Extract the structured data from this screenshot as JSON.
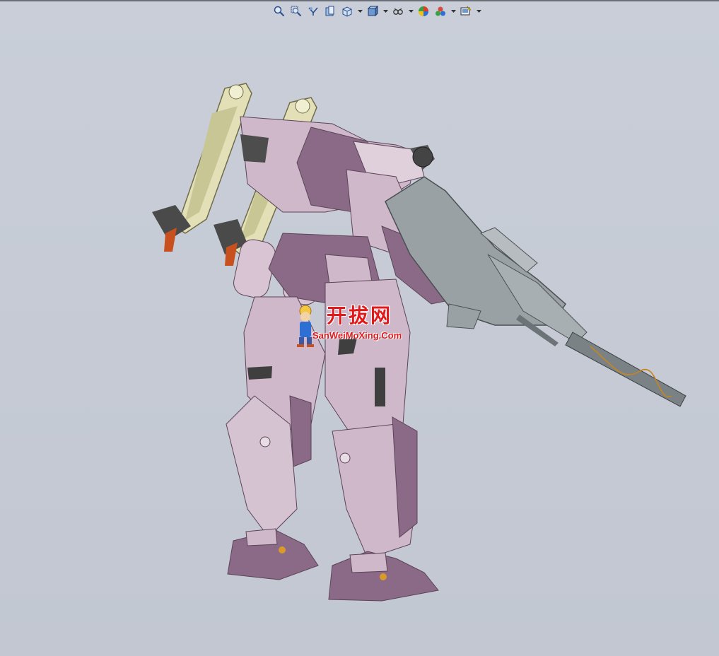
{
  "toolbar": {
    "items": [
      {
        "name": "zoom-to-fit-icon"
      },
      {
        "name": "zoom-to-area-icon"
      },
      {
        "name": "previous-view-icon"
      },
      {
        "name": "section-view-icon"
      },
      {
        "name": "view-orientation-icon",
        "dropdown": true
      },
      {
        "name": "display-style-icon",
        "dropdown": true
      },
      {
        "name": "hide-show-items-icon",
        "dropdown": true
      },
      {
        "name": "edit-appearance-icon"
      },
      {
        "name": "apply-scene-icon",
        "dropdown": true
      },
      {
        "name": "view-settings-icon",
        "dropdown": true
      }
    ]
  },
  "watermark": {
    "title": "开拔网",
    "subtitle": "SanWeiMoXing.Com"
  },
  "colors": {
    "background": "#c6cbd5",
    "armor_light": "#cfb8c9",
    "armor_dark": "#8a6a87",
    "armor_shadow": "#5c4458",
    "missile_pod": "#e3e0b8",
    "weapon_gray": "#9aa1a5",
    "accent_orange": "#c8501e",
    "watermark_red": "#e0191b"
  }
}
